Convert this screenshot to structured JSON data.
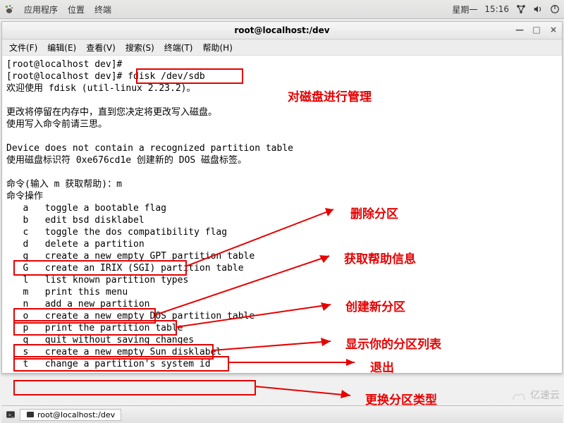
{
  "topbar": {
    "apps": "应用程序",
    "places": "位置",
    "terminal": "终端",
    "date": "星期一",
    "time": "15:16"
  },
  "window": {
    "title": "root@localhost:/dev",
    "minimize": "—",
    "maximize": "□",
    "close": "×"
  },
  "menubar": {
    "file": "文件(F)",
    "edit": "编辑(E)",
    "view": "查看(V)",
    "search": "搜索(S)",
    "terminal": "终端(T)",
    "help": "帮助(H)"
  },
  "terminal": {
    "prompt1": "[root@localhost dev]# ",
    "prompt2": "[root@localhost dev]# ",
    "cmd": "fdisk /dev/sdb",
    "welcome": "欢迎使用 fdisk (util-linux 2.23.2)。",
    "warn1": "更改将停留在内存中，直到您决定将更改写入磁盘。",
    "warn2": "使用写入命令前请三思。",
    "noTable": "Device does not contain a recognized partition table",
    "buildDos": "使用磁盘标识符 0xe676cd1e 创建新的 DOS 磁盘标签。",
    "cmdPrompt": "命令(输入 m 获取帮助)：m",
    "cmdAction": "命令操作",
    "rows": {
      "a": "   a   toggle a bootable flag",
      "b": "   b   edit bsd disklabel",
      "c": "   c   toggle the dos compatibility flag",
      "d": "   d   delete a partition",
      "g": "   g   create a new empty GPT partition table",
      "G": "   G   create an IRIX (SGI) partition table",
      "l": "   l   list known partition types",
      "m": "   m   print this menu",
      "n": "   n   add a new partition",
      "o": "   o   create a new empty DOS partition table",
      "p": "   p   print the partition table",
      "q": "   q   quit without saving changes",
      "s": "   s   create a new empty Sun disklabel",
      "t": "   t   change a partition's system id"
    }
  },
  "annotations": {
    "manage": "对磁盘进行管理",
    "delete": "删除分区",
    "help": "获取帮助信息",
    "new": "创建新分区",
    "print": "显示你的分区列表",
    "quit": "退出",
    "type": "更换分区类型"
  },
  "taskbar": {
    "item": "root@localhost:/dev"
  },
  "watermark": "亿速云"
}
